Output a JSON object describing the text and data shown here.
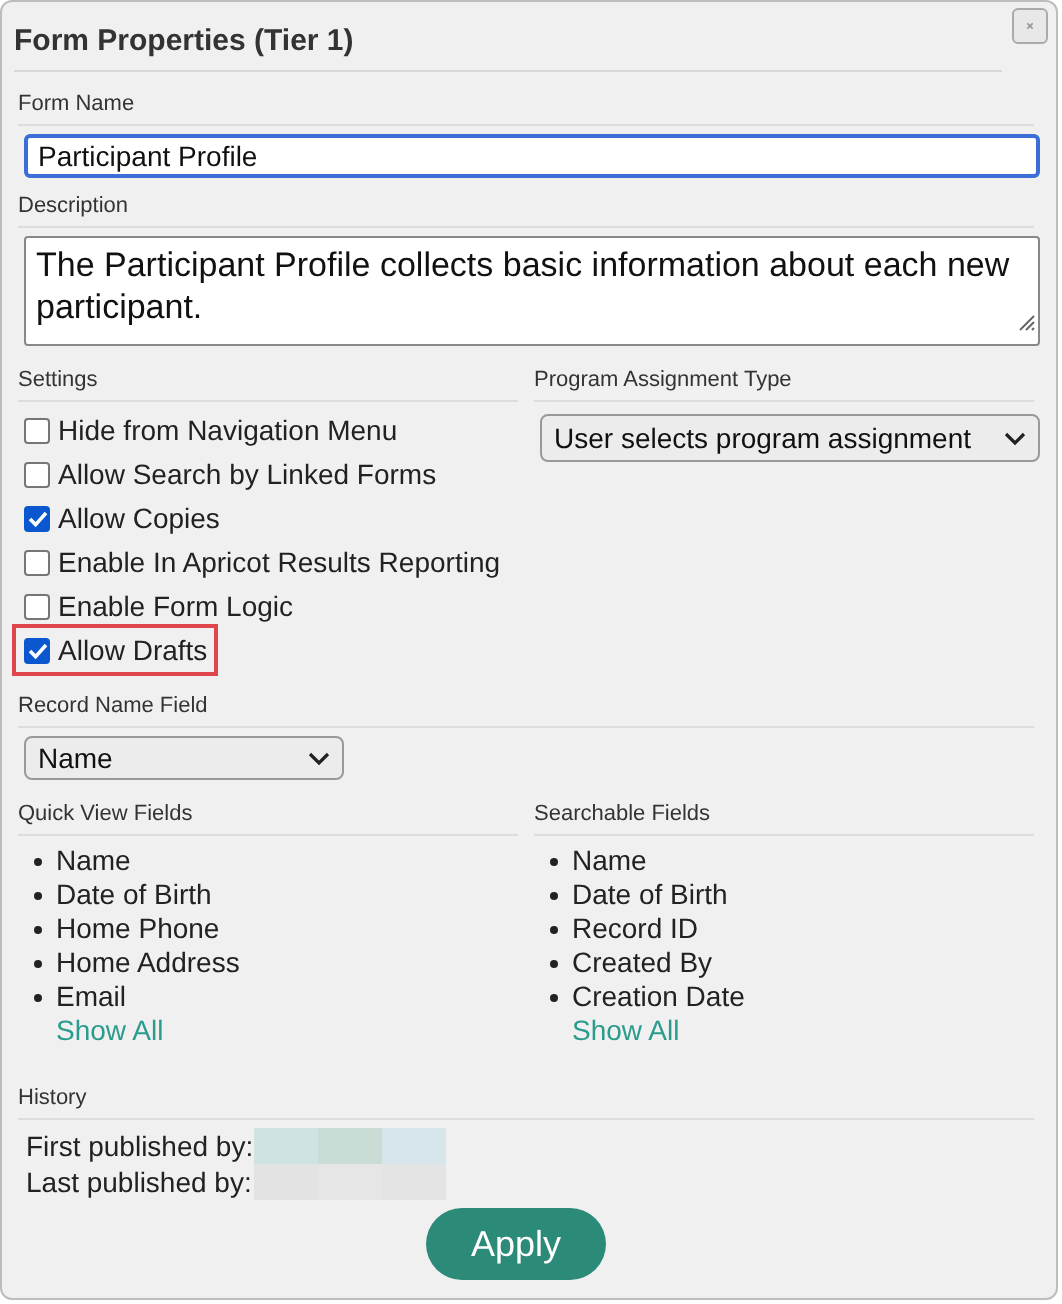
{
  "window": {
    "title": "Form Properties (Tier 1)"
  },
  "form_name": {
    "label": "Form Name",
    "value": "Participant Profile",
    "focused": true
  },
  "description": {
    "label": "Description",
    "value": "The Participant Profile collects basic information about each new participant."
  },
  "settings": {
    "label": "Settings",
    "items": [
      {
        "label": "Hide from Navigation Menu",
        "checked": false,
        "highlighted": false
      },
      {
        "label": "Allow Search by Linked Forms",
        "checked": false,
        "highlighted": false
      },
      {
        "label": "Allow Copies",
        "checked": true,
        "highlighted": false
      },
      {
        "label": "Enable In Apricot Results Reporting",
        "checked": false,
        "highlighted": false
      },
      {
        "label": "Enable Form Logic",
        "checked": false,
        "highlighted": false
      },
      {
        "label": "Allow Drafts",
        "checked": true,
        "highlighted": true
      }
    ]
  },
  "program_assignment_type": {
    "label": "Program Assignment Type",
    "value": "User selects program assignment"
  },
  "record_name_field": {
    "label": "Record Name Field",
    "value": "Name"
  },
  "quick_view_fields": {
    "label": "Quick View Fields",
    "items": [
      "Name",
      "Date of Birth",
      "Home Phone",
      "Home Address",
      "Email"
    ],
    "link": "Show All"
  },
  "searchable_fields": {
    "label": "Searchable Fields",
    "items": [
      "Name",
      "Date of Birth",
      "Record ID",
      "Created By",
      "Creation Date"
    ],
    "link": "Show All"
  },
  "history": {
    "label": "History",
    "rows": [
      {
        "label": "First published by:"
      },
      {
        "label": "Last published by:"
      }
    ]
  },
  "apply_button": "Apply"
}
